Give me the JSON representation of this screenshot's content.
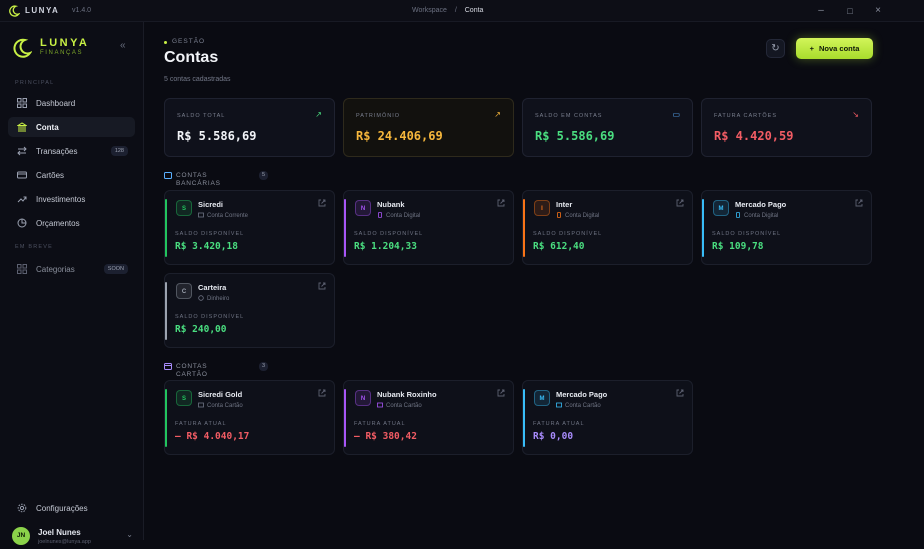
{
  "window": {
    "app_name": "LUNYA",
    "version": "v1.4.0",
    "breadcrumb_parent": "Workspace",
    "breadcrumb_sep": "/",
    "breadcrumb_current": "Conta"
  },
  "brand": {
    "name": "LUNYA",
    "subtitle": "FINANÇAS"
  },
  "sidebar": {
    "section_main": "PRINCIPAL",
    "items": [
      {
        "label": "Dashboard",
        "icon": "grid-icon"
      },
      {
        "label": "Conta",
        "icon": "bank-icon",
        "active": true
      },
      {
        "label": "Transações",
        "icon": "swap-icon",
        "badge": "128"
      },
      {
        "label": "Cartões",
        "icon": "card-icon"
      },
      {
        "label": "Investimentos",
        "icon": "trend-icon"
      },
      {
        "label": "Orçamentos",
        "icon": "pie-icon"
      }
    ],
    "section_soon": "EM BREVE",
    "soon_item": {
      "label": "Categorias",
      "badge": "SOON",
      "icon": "grid-icon"
    },
    "settings": "Configurações",
    "user": {
      "initials": "JN",
      "name": "Joel Nunes",
      "sub": "joelnunes@lunya.app"
    }
  },
  "page": {
    "overline": "GESTÃO",
    "title": "Contas",
    "subtitle": "5 contas cadastradas",
    "new_button": "Nova conta",
    "new_plus": "+"
  },
  "stats": [
    {
      "label": "SALDO TOTAL",
      "value": "R$ 5.586,69",
      "color": "#f2f4f8",
      "icon_color": "#4ade80"
    },
    {
      "label": "PATRIMÔNIO",
      "value": "R$ 24.406,69",
      "color": "#f6b73c",
      "icon_color": "#f6b73c"
    },
    {
      "label": "SALDO EM CONTAS",
      "value": "R$ 5.586,69",
      "color": "#4ade80",
      "icon_color": "#5ab0ff"
    },
    {
      "label": "FATURA CARTÕES",
      "value": "R$ 4.420,59",
      "color": "#f25c64",
      "icon_color": "#f25c64"
    }
  ],
  "bank_group": {
    "label": "CONTAS BANCÁRIAS",
    "count": "5"
  },
  "card_group": {
    "label": "CONTAS CARTÃO",
    "count": "3"
  },
  "balance_label": "SALDO DISPONÍVEL",
  "invoice_label": "FATURA ATUAL",
  "accounts": [
    {
      "initial": "S",
      "name": "Sicredi",
      "type": "Conta Corrente",
      "value": "R$ 3.420,18",
      "accent": "#22c55e",
      "value_color": "#4ade80"
    },
    {
      "initial": "N",
      "name": "Nubank",
      "type": "Conta Digital",
      "value": "R$ 1.204,33",
      "accent": "#a855f7",
      "value_color": "#4ade80"
    },
    {
      "initial": "I",
      "name": "Inter",
      "type": "Conta Digital",
      "value": "R$ 612,40",
      "accent": "#f97316",
      "value_color": "#4ade80"
    },
    {
      "initial": "M",
      "name": "Mercado Pago",
      "type": "Conta Digital",
      "value": "R$ 109,78",
      "accent": "#38bdf8",
      "value_color": "#4ade80"
    },
    {
      "initial": "C",
      "name": "Carteira",
      "type": "Dinheiro",
      "value": "R$ 240,00",
      "accent": "#9ca3af",
      "value_color": "#4ade80"
    }
  ],
  "cards": [
    {
      "initial": "S",
      "name": "Sicredi Gold",
      "type": "Conta Cartão",
      "value": "– R$ 4.040,17",
      "accent": "#22c55e",
      "value_color": "#f25c64"
    },
    {
      "initial": "N",
      "name": "Nubank Roxinho",
      "type": "Conta Cartão",
      "value": "– R$ 380,42",
      "accent": "#a855f7",
      "value_color": "#f25c64"
    },
    {
      "initial": "M",
      "name": "Mercado Pago",
      "type": "Conta Cartão",
      "value": "R$ 0,00",
      "accent": "#38bdf8",
      "value_color": "#a78bfa"
    }
  ]
}
